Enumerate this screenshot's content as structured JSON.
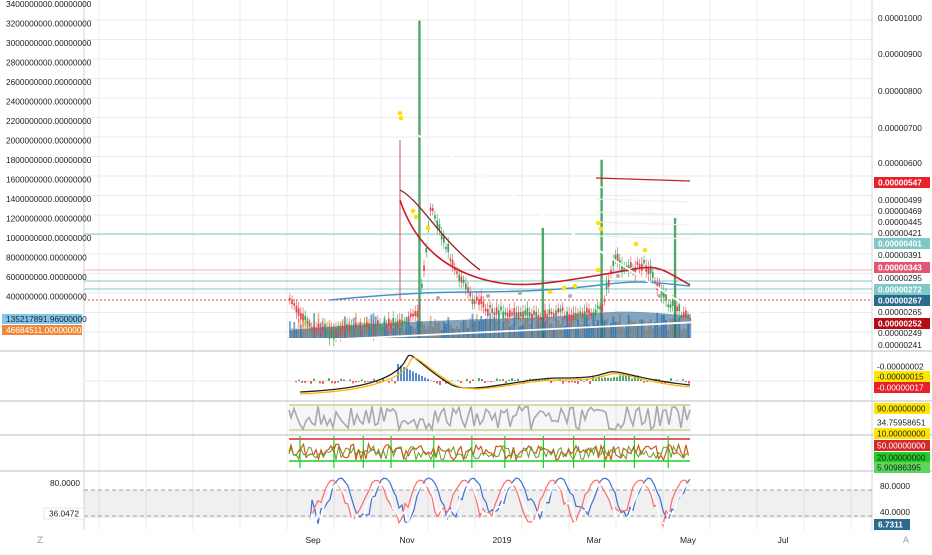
{
  "colors": {
    "grid": "#e8ebef",
    "axis_text": "#222222",
    "price_up": "#3aa055",
    "price_down": "#e0484f",
    "volume_blue": "#3f86c5",
    "volume_orange": "#f0a860",
    "trendline": "#ffffff",
    "signal_marker": "#ffe000",
    "macd_line": "#222222",
    "rsi_line": "#a9a9a9",
    "stoch_k": "#3f6fd6",
    "stoch_d": "#ff6b6b",
    "stoch_line": "#ffffff"
  },
  "left_axis": {
    "ticks": [
      "3400000000.00000000",
      "3200000000.00000000",
      "3000000000.00000000",
      "2800000000.00000000",
      "2600000000.00000000",
      "2400000000.00000000",
      "2200000000.00000000",
      "2000000000.00000000",
      "1800000000.00000000",
      "1600000000.00000000",
      "1400000000.00000000",
      "1200000000.00000000",
      "1000000000.00000000",
      "800000000.00000000",
      "600000000.00000000",
      "400000000.00000000"
    ],
    "badges": [
      {
        "label": "135217891.96000000",
        "color": "#7ec8f0"
      },
      {
        "label": "46684511.00000000",
        "color": "#f0883a"
      }
    ]
  },
  "right_axis": {
    "ticks": [
      "0.00001000",
      "0.00000900",
      "0.00000800",
      "0.00000700",
      "0.00000600",
      "0.00000499",
      "0.00000469",
      "0.00000445",
      "0.00000421",
      "0.00000391",
      "0.00000295",
      "0.00000265",
      "0.00000249",
      "0.00000241"
    ],
    "badges": [
      {
        "label": "0.00000547",
        "color": "#e8202a",
        "text_color": "#ffffff"
      },
      {
        "label": "0.00000401",
        "color": "#7fc8c8",
        "text_color": "#ffffff"
      },
      {
        "label": "0.00000343",
        "color": "#e25673",
        "text_color": "#ffffff"
      },
      {
        "label": "0.00000272",
        "color": "#7fc8c8",
        "text_color": "#ffffff"
      },
      {
        "label": "0.00000267",
        "color": "#2b6a8f",
        "text_color": "#ffffff"
      },
      {
        "label": "0.00000252",
        "color": "#b50d14",
        "text_color": "#ffffff"
      }
    ]
  },
  "macd_axis": {
    "labels": [
      {
        "label": "-0.00000002",
        "color": "#ffffff",
        "text_color": "#222222"
      },
      {
        "label": "-0.00000015",
        "color": "#ffe600",
        "text_color": "#222222"
      },
      {
        "label": "-0.00000017",
        "color": "#e8202a",
        "text_color": "#ffffff"
      }
    ]
  },
  "rsi_axis": {
    "labels": [
      {
        "label": "90.00000000",
        "color": "#ffe600",
        "text_color": "#222222"
      },
      {
        "label": "34.75958651",
        "color": "#ffffff",
        "text_color": "#222222"
      },
      {
        "label": "10.00000000",
        "color": "#ffe600",
        "text_color": "#222222"
      },
      {
        "label": "50.00000000",
        "color": "#d42a2a",
        "text_color": "#ffffff"
      },
      {
        "label": "20.00000000",
        "color": "#22cc22",
        "text_color": "#222222"
      },
      {
        "label": "5.90986395",
        "color": "#5ad85a",
        "text_color": "#222222"
      }
    ]
  },
  "stoch_axis": {
    "left_ticks": [
      "80.0000"
    ],
    "left_badge": "36.0472",
    "right_ticks": [
      "80.0000",
      "40.0000"
    ],
    "right_badge": "6.7311"
  },
  "time_axis": {
    "labels": [
      "Sep",
      "Nov",
      "2019",
      "Mar",
      "May",
      "Jul"
    ]
  },
  "corner_buttons": {
    "left": "Z",
    "right": "A"
  },
  "chart_data": {
    "type": "candlestick",
    "title": "",
    "price_scale": "log",
    "grid": true,
    "x_range": [
      "2018-07",
      "2019-08"
    ],
    "price": {
      "dates": [
        "2018-08-01",
        "2018-08-15",
        "2018-09-01",
        "2018-09-15",
        "2018-10-01",
        "2018-10-15",
        "2018-10-28",
        "2018-11-05",
        "2018-11-15",
        "2018-12-01",
        "2018-12-15",
        "2019-01-01",
        "2019-01-15",
        "2019-02-01",
        "2019-02-15",
        "2019-03-01",
        "2019-03-10",
        "2019-03-20",
        "2019-04-01",
        "2019-04-15",
        "2019-05-01"
      ],
      "close": [
        2.9e-06,
        2.62e-06,
        2.54e-06,
        2.58e-06,
        2.62e-06,
        2.66e-06,
        2.75e-06,
        4.45e-06,
        3.72e-06,
        2.98e-06,
        2.81e-06,
        2.76e-06,
        2.74e-06,
        2.78e-06,
        2.73e-06,
        2.81e-06,
        3.5e-06,
        3.36e-06,
        3.42e-06,
        2.91e-06,
        2.67e-06
      ]
    },
    "volume": {
      "spikes": [
        {
          "date": "2018-10-28",
          "value": 3230000000
        },
        {
          "date": "2019-03-01",
          "value": 1800000000
        },
        {
          "date": "2019-04-20",
          "value": 1200000000
        },
        {
          "date": "2019-01-20",
          "value": 1100000000
        }
      ],
      "last_sma": 135217891.96,
      "last": 46684511.0
    },
    "trendlines": [
      {
        "from": {
          "date": "2018-10-28",
          "price": 6e-06
        },
        "to": {
          "date": "2019-05-15",
          "price": 2.67e-06
        }
      },
      {
        "from": {
          "date": "2018-09-01",
          "price": 2.47e-06
        },
        "to": {
          "date": "2019-05-15",
          "price": 2.67e-06
        }
      }
    ],
    "macd": {
      "shown_values": [
        -2e-08,
        -1.5e-07,
        -1.7e-07
      ]
    },
    "rsi": {
      "levels": [
        90,
        50,
        20,
        10
      ],
      "current": 34.75958651,
      "secondary": 5.90986395
    },
    "stoch_rsi": {
      "levels": [
        80,
        40
      ],
      "current": 6.7311,
      "line_value": 36.0472
    }
  }
}
